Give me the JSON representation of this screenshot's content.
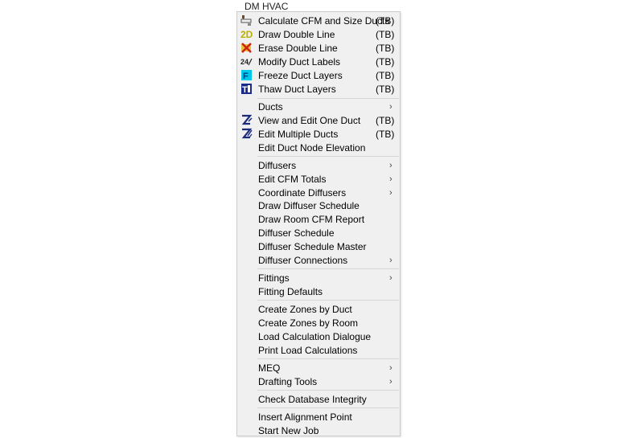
{
  "title": "DM HVAC",
  "items": [
    {
      "label": "Calculate CFM and Size Ducts",
      "shortcut": "(TB)",
      "icon": "duct-size-icon"
    },
    {
      "label": "Draw Double Line",
      "shortcut": "(TB)",
      "icon": "double-line-2d-icon"
    },
    {
      "label": "Erase Double Line",
      "shortcut": "(TB)",
      "icon": "erase-double-line-icon"
    },
    {
      "label": "Modify Duct Labels",
      "shortcut": "(TB)",
      "icon": "duct-labels-icon"
    },
    {
      "label": "Freeze Duct Layers",
      "shortcut": "(TB)",
      "icon": "freeze-layers-icon"
    },
    {
      "label": "Thaw Duct Layers",
      "shortcut": "(TB)",
      "icon": "thaw-layers-icon"
    },
    {
      "label": "Ducts",
      "submenu": true
    },
    {
      "label": "View and Edit One Duct",
      "shortcut": "(TB)",
      "icon": "edit-duct-icon"
    },
    {
      "label": "Edit Multiple Ducts",
      "shortcut": "(TB)",
      "icon": "edit-multiple-ducts-icon"
    },
    {
      "label": "Edit Duct Node Elevation"
    },
    {
      "label": "Diffusers",
      "submenu": true
    },
    {
      "label": "Edit CFM Totals",
      "submenu": true
    },
    {
      "label": "Coordinate Diffusers",
      "submenu": true
    },
    {
      "label": "Draw Diffuser Schedule"
    },
    {
      "label": "Draw Room CFM Report"
    },
    {
      "label": "Diffuser Schedule"
    },
    {
      "label": "Diffuser Schedule Master"
    },
    {
      "label": "Diffuser Connections",
      "submenu": true
    },
    {
      "label": "Fittings",
      "submenu": true
    },
    {
      "label": "Fitting Defaults"
    },
    {
      "label": "Create Zones by Duct"
    },
    {
      "label": "Create Zones by Room"
    },
    {
      "label": "Load Calculation Dialogue"
    },
    {
      "label": "Print Load Calculations"
    },
    {
      "label": "MEQ",
      "submenu": true
    },
    {
      "label": "Drafting Tools",
      "submenu": true
    },
    {
      "label": "Check Database Integrity"
    },
    {
      "label": "Insert Alignment Point"
    },
    {
      "label": "Start New Job"
    }
  ],
  "submenu_arrow": "›"
}
